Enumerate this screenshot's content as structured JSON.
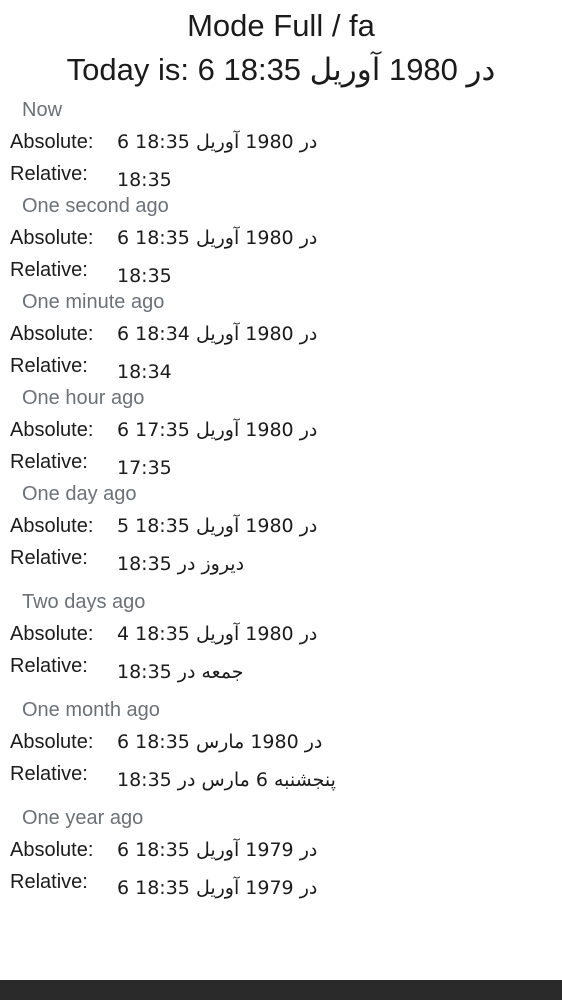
{
  "header": {
    "title": "Mode Full / fa",
    "today": "Today is: 6 18:35 در 1980 آوریل"
  },
  "labels": {
    "absolute": "Absolute:",
    "relative": "Relative:"
  },
  "sections": [
    {
      "title": "Now",
      "absolute": "6 18:35 در 1980 آوریل",
      "relative": "18:35"
    },
    {
      "title": "One second ago",
      "absolute": "6 18:35 در 1980 آوریل",
      "relative": "18:35"
    },
    {
      "title": "One minute ago",
      "absolute": "6 18:34 در 1980 آوریل",
      "relative": "18:34"
    },
    {
      "title": "One hour ago",
      "absolute": "6 17:35 در 1980 آوریل",
      "relative": "17:35"
    },
    {
      "title": "One day ago",
      "absolute": "5 18:35 در 1980 آوریل",
      "relative": "18:35 دیروز در"
    },
    {
      "title": "Two days ago",
      "absolute": "4 18:35 در 1980 آوریل",
      "relative": "18:35 جمعه در"
    },
    {
      "title": "One month ago",
      "absolute": "6 18:35 در 1980 مارس",
      "relative": "18:35 پنجشنبه 6 مارس در"
    },
    {
      "title": "One year ago",
      "absolute": "6 18:35 در 1979 آوریل",
      "relative": "6 18:35 در 1979 آوریل"
    }
  ]
}
